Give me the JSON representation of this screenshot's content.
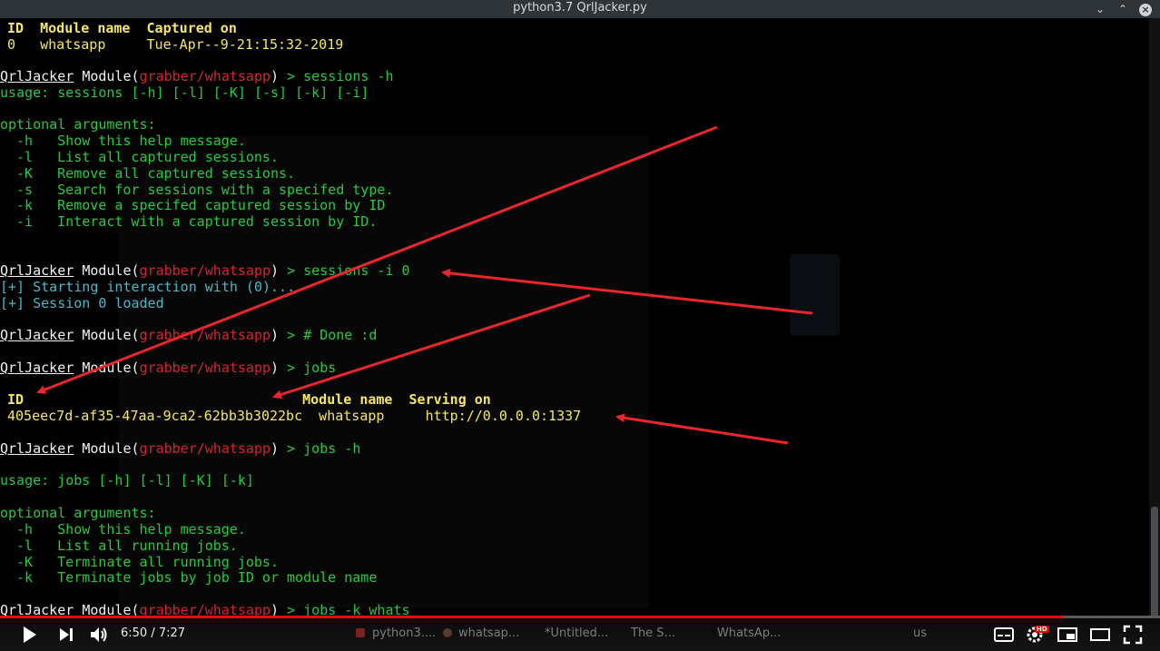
{
  "window": {
    "title": "python3.7 QrlJacker.py",
    "minimize": "⌄",
    "maximize": "⌃"
  },
  "terminal": {
    "prompt": {
      "app": "QrlJacker",
      "module_word": "Module(",
      "module_path": "grabber/whatsapp",
      "close": ")",
      "arrow": " > "
    },
    "sessions_header": {
      "id": "ID",
      "module": "Module name",
      "captured": "Captured on"
    },
    "sessions_row": {
      "id": "0",
      "module": "whatsapp",
      "captured": "Tue-Apr--9-21:15:32-2019"
    },
    "cmd_sessions_h": "sessions -h",
    "sessions_usage": "usage: sessions [-h] [-l] [-K] [-s] [-k] [-i]",
    "optional_arguments": "optional arguments:",
    "sessions_opts": [
      {
        "flag": "-h",
        "desc": "Show this help message."
      },
      {
        "flag": "-l",
        "desc": "List all captured sessions."
      },
      {
        "flag": "-K",
        "desc": "Remove all captured sessions."
      },
      {
        "flag": "-s",
        "desc": "Search for sessions with a specifed type."
      },
      {
        "flag": "-k",
        "desc": "Remove a specifed captured session by ID"
      },
      {
        "flag": "-i",
        "desc": "Interact with a captured session by ID."
      }
    ],
    "cmd_sessions_i": "sessions -i 0",
    "status_1": "[+] Starting interaction with (0)...",
    "status_2": "[+] Session 0 loaded",
    "cmd_done": "# Done :d",
    "cmd_jobs": "jobs",
    "jobs_header": {
      "id": "ID",
      "module": "Module name",
      "serving": "Serving on"
    },
    "jobs_row": {
      "id": "405eec7d-af35-47aa-9ca2-62bb3b3022bc",
      "module": "whatsapp",
      "serving": "http://0.0.0.0:1337"
    },
    "cmd_jobs_h": "jobs -h",
    "jobs_usage": "usage: jobs [-h] [-l] [-K] [-k]",
    "jobs_opts": [
      {
        "flag": "-h",
        "desc": "Show this help message."
      },
      {
        "flag": "-l",
        "desc": "List all running jobs."
      },
      {
        "flag": "-K",
        "desc": "Terminate all running jobs."
      },
      {
        "flag": "-k",
        "desc": "Terminate jobs by job ID or module name"
      }
    ],
    "cmd_jobs_k": "jobs -k whats"
  },
  "player": {
    "current_time": "6:50",
    "total_time": "7:27",
    "time_display": "6:50 / 7:27",
    "progress_fraction": 0.917,
    "hd_badge": "HD",
    "taskbar": [
      "python3....",
      "whatsap...",
      "*Untitled...",
      "The S...",
      "WhatsAp..."
    ],
    "keyboard_layout": "us"
  },
  "colors": {
    "prompt_green": "#27c93f",
    "module_red": "#d2262c",
    "info_cyan": "#4bb6c7",
    "progress_red": "#ff0000",
    "arrow_red": "#e8262b"
  }
}
